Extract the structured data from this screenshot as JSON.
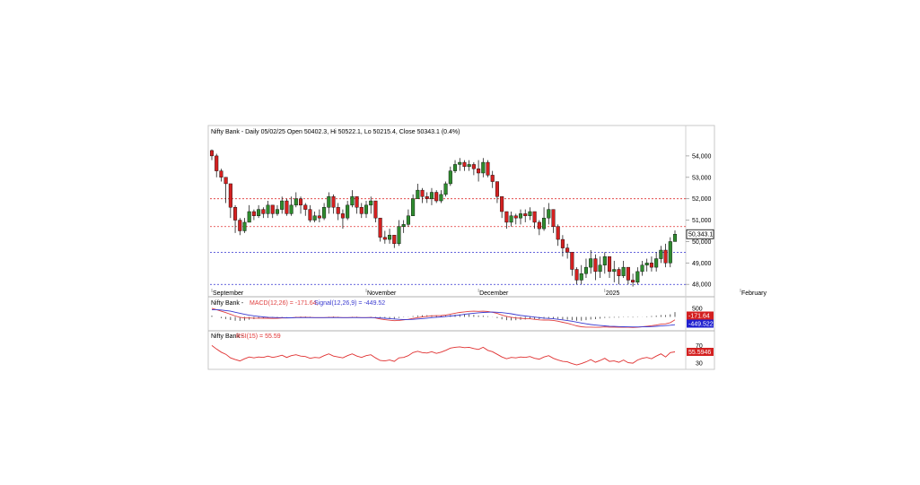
{
  "header": {
    "title": "Nifty Bank - Daily 05/02/25 Open 50402.3, Hi 50522.1, Lo 50215.4, Close 50343.1 (0.4%)"
  },
  "price_axis": {
    "ticks": [
      {
        "value": 54000,
        "label": "54,000"
      },
      {
        "value": 53000,
        "label": "53,000"
      },
      {
        "value": 52000,
        "label": "52,000"
      },
      {
        "value": 51000,
        "label": "51,000"
      },
      {
        "value": 50000,
        "label": "50,000"
      },
      {
        "value": 49000,
        "label": "49,000"
      },
      {
        "value": 48000,
        "label": "48,000"
      }
    ],
    "last_price_label": "50,343.1",
    "last_price": 50343.1
  },
  "x_axis": {
    "labels": [
      {
        "label": "September",
        "index": 0
      },
      {
        "label": "November",
        "index": 33
      },
      {
        "label": "December",
        "index": 57
      },
      {
        "label": "2025",
        "index": 84
      },
      {
        "label": "February",
        "index": 113
      }
    ]
  },
  "reference_lines": [
    {
      "value": 52000,
      "color": "#e03030"
    },
    {
      "value": 50700,
      "color": "#e03030"
    },
    {
      "value": 49500,
      "color": "#3030d0"
    },
    {
      "value": 48000,
      "color": "#3030d0"
    }
  ],
  "colors": {
    "up": "#2e8b2e",
    "down": "#d42020",
    "macd": "#e04040",
    "signal": "#3a3ad0",
    "rsi": "#e03030"
  },
  "chart_data": [
    {
      "type": "candlestick",
      "title": "Nifty Bank - Daily 05/02/25 Open 50402.3, Hi 50522.1, Lo 50215.4, Close 50343.1 (0.4%)",
      "ylim": [
        47800,
        55000
      ],
      "closes": [
        54000,
        53300,
        53000,
        52700,
        51600,
        51000,
        50500,
        50900,
        51400,
        51200,
        51500,
        51300,
        51700,
        51300,
        51500,
        51900,
        51300,
        51700,
        52000,
        51700,
        51500,
        51000,
        51200,
        51100,
        51600,
        52100,
        51600,
        51300,
        51100,
        51700,
        52100,
        51600,
        51300,
        51700,
        51900,
        51100,
        50200,
        50100,
        50300,
        49900,
        50700,
        50800,
        51200,
        52000,
        52400,
        52100,
        52000,
        52300,
        51900,
        52200,
        52700,
        53300,
        53600,
        53700,
        53500,
        53600,
        53400,
        53200,
        53700,
        53100,
        52800,
        52100,
        51400,
        50900,
        51200,
        51100,
        51300,
        51200,
        51400,
        50900,
        50600,
        51100,
        51500,
        50700,
        50100,
        49700,
        49500,
        48700,
        48200,
        48500,
        48800,
        49200,
        48600,
        48900,
        49300,
        48600,
        48700,
        48400,
        48800,
        48200,
        48100,
        48600,
        48900,
        49000,
        48800,
        49200,
        49600,
        49000,
        50000,
        50343
      ],
      "highs": [
        54300,
        54100,
        53400,
        53000,
        52200,
        51700,
        51100,
        51100,
        51700,
        51500,
        51700,
        51600,
        51900,
        51700,
        51700,
        52100,
        52000,
        52100,
        52300,
        52100,
        51800,
        51700,
        51400,
        51500,
        51800,
        52300,
        52200,
        51800,
        51500,
        51900,
        52400,
        52000,
        51800,
        51900,
        52100,
        51900,
        51000,
        50500,
        50600,
        50300,
        51000,
        51000,
        51500,
        52200,
        52700,
        52500,
        52300,
        52500,
        52400,
        52400,
        52800,
        53500,
        53800,
        53900,
        53800,
        53800,
        53700,
        53800,
        53900,
        53800,
        53300,
        52800,
        52000,
        51300,
        51400,
        51300,
        51500,
        51500,
        51600,
        51400,
        51000,
        51600,
        51800,
        51500,
        50800,
        50300,
        49900,
        49300,
        48800,
        48900,
        49200,
        49600,
        49400,
        49300,
        49500,
        49200,
        49100,
        48800,
        49100,
        48800,
        48500,
        48800,
        49100,
        49200,
        49300,
        49500,
        49800,
        49900,
        50200,
        50522
      ],
      "lows": [
        53800,
        53000,
        52800,
        51800,
        51100,
        50400,
        50300,
        50400,
        51000,
        51000,
        51100,
        51100,
        51100,
        51100,
        51200,
        51300,
        51200,
        51200,
        51600,
        51300,
        51200,
        50900,
        50900,
        50900,
        51000,
        51300,
        51300,
        51000,
        50600,
        51000,
        51600,
        51300,
        51100,
        51100,
        51300,
        50900,
        50000,
        49900,
        49900,
        49700,
        49800,
        50400,
        50700,
        51700,
        52000,
        51800,
        51800,
        51700,
        51800,
        51800,
        52100,
        52600,
        53200,
        53300,
        53300,
        53300,
        53100,
        52800,
        53000,
        53000,
        52500,
        51800,
        51100,
        50600,
        50700,
        50800,
        50800,
        50900,
        51000,
        50600,
        50300,
        50500,
        50800,
        50400,
        49800,
        49300,
        49200,
        48400,
        48000,
        48000,
        48300,
        48500,
        48200,
        48300,
        48500,
        48300,
        48100,
        48000,
        48300,
        48000,
        47900,
        48000,
        48400,
        48600,
        48600,
        48600,
        49000,
        48800,
        48800,
        50215
      ]
    },
    {
      "type": "line",
      "title": "Nifty Bank - MACD(12,26) = -171.64, Signal(12,26,9) = -449.52",
      "ylim": [
        -700,
        700
      ],
      "series": [
        {
          "name": "MACD(12,26)",
          "values": [
            500,
            420,
            330,
            250,
            150,
            50,
            -20,
            -60,
            -60,
            -70,
            -70,
            -80,
            -80,
            -90,
            -80,
            -60,
            -60,
            -50,
            -30,
            -20,
            -20,
            -30,
            -40,
            -40,
            -40,
            -30,
            -20,
            -30,
            -40,
            -40,
            -30,
            -30,
            -40,
            -40,
            -30,
            -60,
            -120,
            -160,
            -190,
            -220,
            -200,
            -170,
            -140,
            -90,
            -40,
            0,
            30,
            60,
            70,
            80,
            110,
            160,
            210,
            260,
            290,
            320,
            330,
            320,
            330,
            310,
            270,
            200,
            110,
            30,
            -20,
            -60,
            -80,
            -100,
            -110,
            -140,
            -170,
            -180,
            -180,
            -200,
            -250,
            -310,
            -370,
            -440,
            -520,
            -570,
            -590,
            -590,
            -600,
            -600,
            -580,
            -590,
            -590,
            -600,
            -590,
            -600,
            -610,
            -600,
            -570,
            -540,
            -510,
            -470,
            -420,
            -400,
            -330,
            -172
          ]
        },
        {
          "name": "Signal(12,26,9)",
          "values": [
            420,
            420,
            400,
            370,
            330,
            270,
            210,
            150,
            100,
            60,
            30,
            0,
            -20,
            -30,
            -40,
            -40,
            -50,
            -50,
            -40,
            -40,
            -40,
            -40,
            -40,
            -40,
            -40,
            -40,
            -40,
            -40,
            -40,
            -40,
            -40,
            -40,
            -40,
            -40,
            -40,
            -40,
            -60,
            -80,
            -100,
            -120,
            -140,
            -150,
            -150,
            -140,
            -120,
            -100,
            -70,
            -40,
            -20,
            0,
            20,
            50,
            80,
            110,
            150,
            180,
            210,
            240,
            260,
            270,
            280,
            270,
            250,
            220,
            180,
            130,
            90,
            50,
            20,
            -10,
            -40,
            -70,
            -90,
            -110,
            -140,
            -170,
            -210,
            -250,
            -300,
            -350,
            -400,
            -440,
            -470,
            -500,
            -520,
            -540,
            -550,
            -560,
            -570,
            -575,
            -580,
            -580,
            -575,
            -570,
            -560,
            -545,
            -525,
            -505,
            -480,
            -450
          ]
        }
      ],
      "histogram": [
        80,
        0,
        -70,
        -120,
        -180,
        -220,
        -230,
        -210,
        -160,
        -130,
        -100,
        -80,
        -60,
        -60,
        -40,
        -20,
        -10,
        0,
        10,
        20,
        20,
        10,
        0,
        0,
        0,
        10,
        20,
        10,
        0,
        0,
        10,
        10,
        0,
        0,
        10,
        -20,
        -60,
        -80,
        -90,
        -100,
        -60,
        -20,
        10,
        50,
        80,
        100,
        100,
        100,
        90,
        80,
        90,
        110,
        130,
        150,
        140,
        140,
        120,
        80,
        70,
        40,
        -10,
        -70,
        -140,
        -190,
        -200,
        -190,
        -170,
        -150,
        -130,
        -130,
        -130,
        -110,
        -90,
        -90,
        -110,
        -140,
        -160,
        -190,
        -220,
        -220,
        -190,
        -150,
        -130,
        -100,
        -60,
        -50,
        -40,
        -40,
        -20,
        -25,
        -30,
        -20,
        5,
        30,
        50,
        75,
        105,
        105,
        150,
        278
      ],
      "ticks": [
        {
          "value": 500,
          "label": "500"
        }
      ],
      "value_boxes": [
        {
          "label": "-171.64",
          "value": -171.64,
          "color": "#d42020"
        },
        {
          "label": "-449.522",
          "value": -449.52,
          "color": "#2020d0"
        }
      ]
    },
    {
      "type": "line",
      "title": "Nifty Bank - RSI(15) = 55.59",
      "ylim": [
        20,
        85
      ],
      "series": [
        {
          "name": "RSI(15)",
          "values": [
            70,
            62,
            55,
            50,
            42,
            38,
            35,
            40,
            44,
            42,
            44,
            43,
            46,
            43,
            45,
            48,
            43,
            47,
            49,
            46,
            45,
            41,
            43,
            42,
            47,
            51,
            46,
            44,
            42,
            47,
            51,
            46,
            43,
            47,
            49,
            42,
            36,
            35,
            37,
            34,
            42,
            43,
            47,
            54,
            57,
            54,
            53,
            56,
            52,
            55,
            59,
            64,
            66,
            67,
            65,
            66,
            63,
            61,
            66,
            59,
            56,
            50,
            44,
            40,
            43,
            42,
            44,
            43,
            45,
            41,
            39,
            44,
            47,
            41,
            37,
            34,
            33,
            29,
            26,
            29,
            33,
            38,
            32,
            36,
            41,
            34,
            35,
            32,
            37,
            31,
            30,
            37,
            41,
            43,
            40,
            46,
            51,
            44,
            54,
            55.59
          ]
        }
      ],
      "ticks": [
        {
          "value": 70,
          "label": "70"
        },
        {
          "value": 30,
          "label": "30"
        }
      ],
      "value_boxes": [
        {
          "label": "55.5946",
          "value": 55.59,
          "color": "#d42020"
        }
      ]
    }
  ]
}
